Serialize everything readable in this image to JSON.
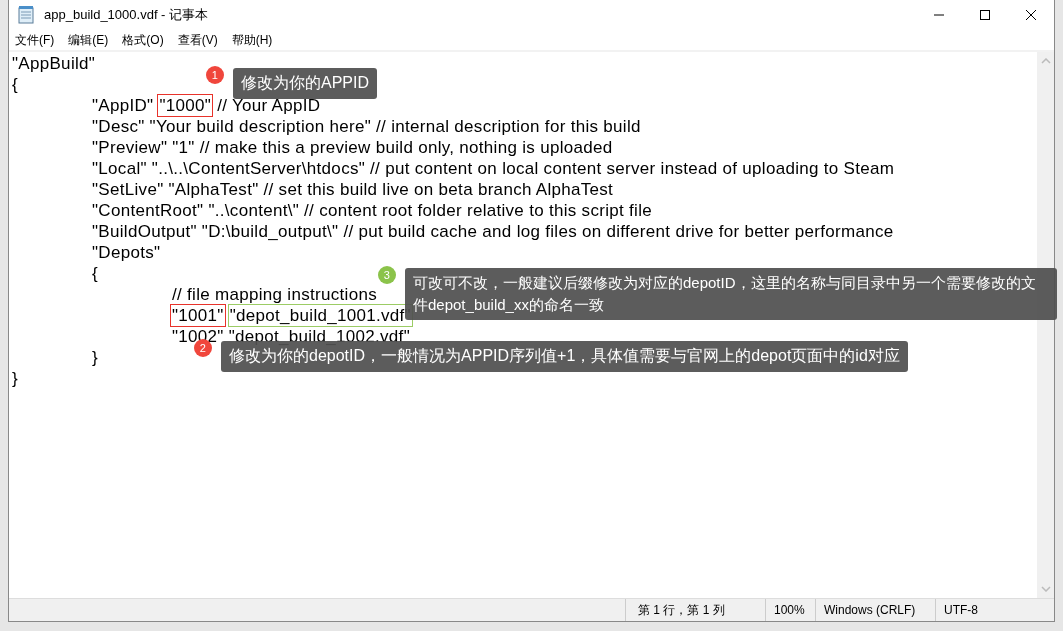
{
  "window": {
    "title": "app_build_1000.vdf - 记事本"
  },
  "menu": [
    "文件(F)",
    "编辑(E)",
    "格式(O)",
    "查看(V)",
    "帮助(H)"
  ],
  "lines": [
    {
      "segments": [
        {
          "text": "\"AppBuild\""
        }
      ]
    },
    {
      "segments": [
        {
          "text": "{"
        }
      ],
      "children": [
        {
          "segments": [
            {
              "text": "\"AppID\""
            },
            {
              "text": "\"1000\"",
              "color": "#e8322a"
            },
            {
              "text": "// Your AppID"
            }
          ]
        },
        {
          "segments": [
            {
              "text": "\"Desc\" \"Your build description here\" // internal description for this build"
            }
          ]
        },
        {
          "segments": [
            {
              "text": "\"Preview\" \"1\" // make this a preview build only, nothing is uploaded"
            }
          ]
        },
        {
          "segments": [
            {
              "text": "\"Local\" \"..\\..\\ContentServer\\htdocs\" // put content on local content server instead of uploading to Steam"
            }
          ]
        },
        {
          "segments": [
            {
              "text": "\"SetLive\" \"AlphaTest\" // set this build live on beta branch AlphaTest"
            }
          ]
        },
        {
          "segments": [
            {
              "text": "\"ContentRoot\" \"..\\content\\\" // content root folder relative to this script file"
            }
          ]
        },
        {
          "segments": [
            {
              "text": "\"BuildOutput\" \"D:\\build_output\\\" // put build cache and log files on different drive for better performance"
            }
          ]
        },
        {
          "segments": [
            {
              "text": "\"Depots\""
            }
          ]
        },
        {
          "segments": [
            {
              "text": "{"
            }
          ],
          "children": [
            {
              "segments": [
                {
                  "text": "// file mapping instructions"
                }
              ]
            },
            {
              "segments": [
                {
                  "text": "\"1001\"",
                  "color": "#e8322a"
                },
                {
                  "text": "\"depot_build_1001.vdf\"",
                  "color": "#9ccc65"
                }
              ]
            },
            {
              "segments": [
                {
                  "text": "\"1002\" \"depot_build_1002.vdf\""
                }
              ]
            }
          ]
        },
        {
          "segments": [
            {
              "text": "}"
            }
          ]
        }
      ]
    },
    {
      "segments": [
        {
          "text": "}"
        }
      ]
    }
  ],
  "callouts": [
    {
      "number": "1",
      "color": "#f0463c",
      "text": "修改为你的APPID"
    },
    {
      "number": "3",
      "color": "#8bc34a",
      "text": "可改可不改，一般建议后缀修改为对应的depotID，这里的名称与同目录中另一个需要修改的文件depot_build_xx的命名一致"
    },
    {
      "number": "2",
      "color": "#f0463c",
      "text": "修改为你的depotID，一般情况为APPID序列值+1，具体值需要与官网上的depot页面中的id对应"
    }
  ],
  "status_bar": {
    "position": "第 1 行，第 1 列",
    "zoom": "100%",
    "line_ending": "Windows (CRLF)",
    "encoding": "UTF-8"
  }
}
